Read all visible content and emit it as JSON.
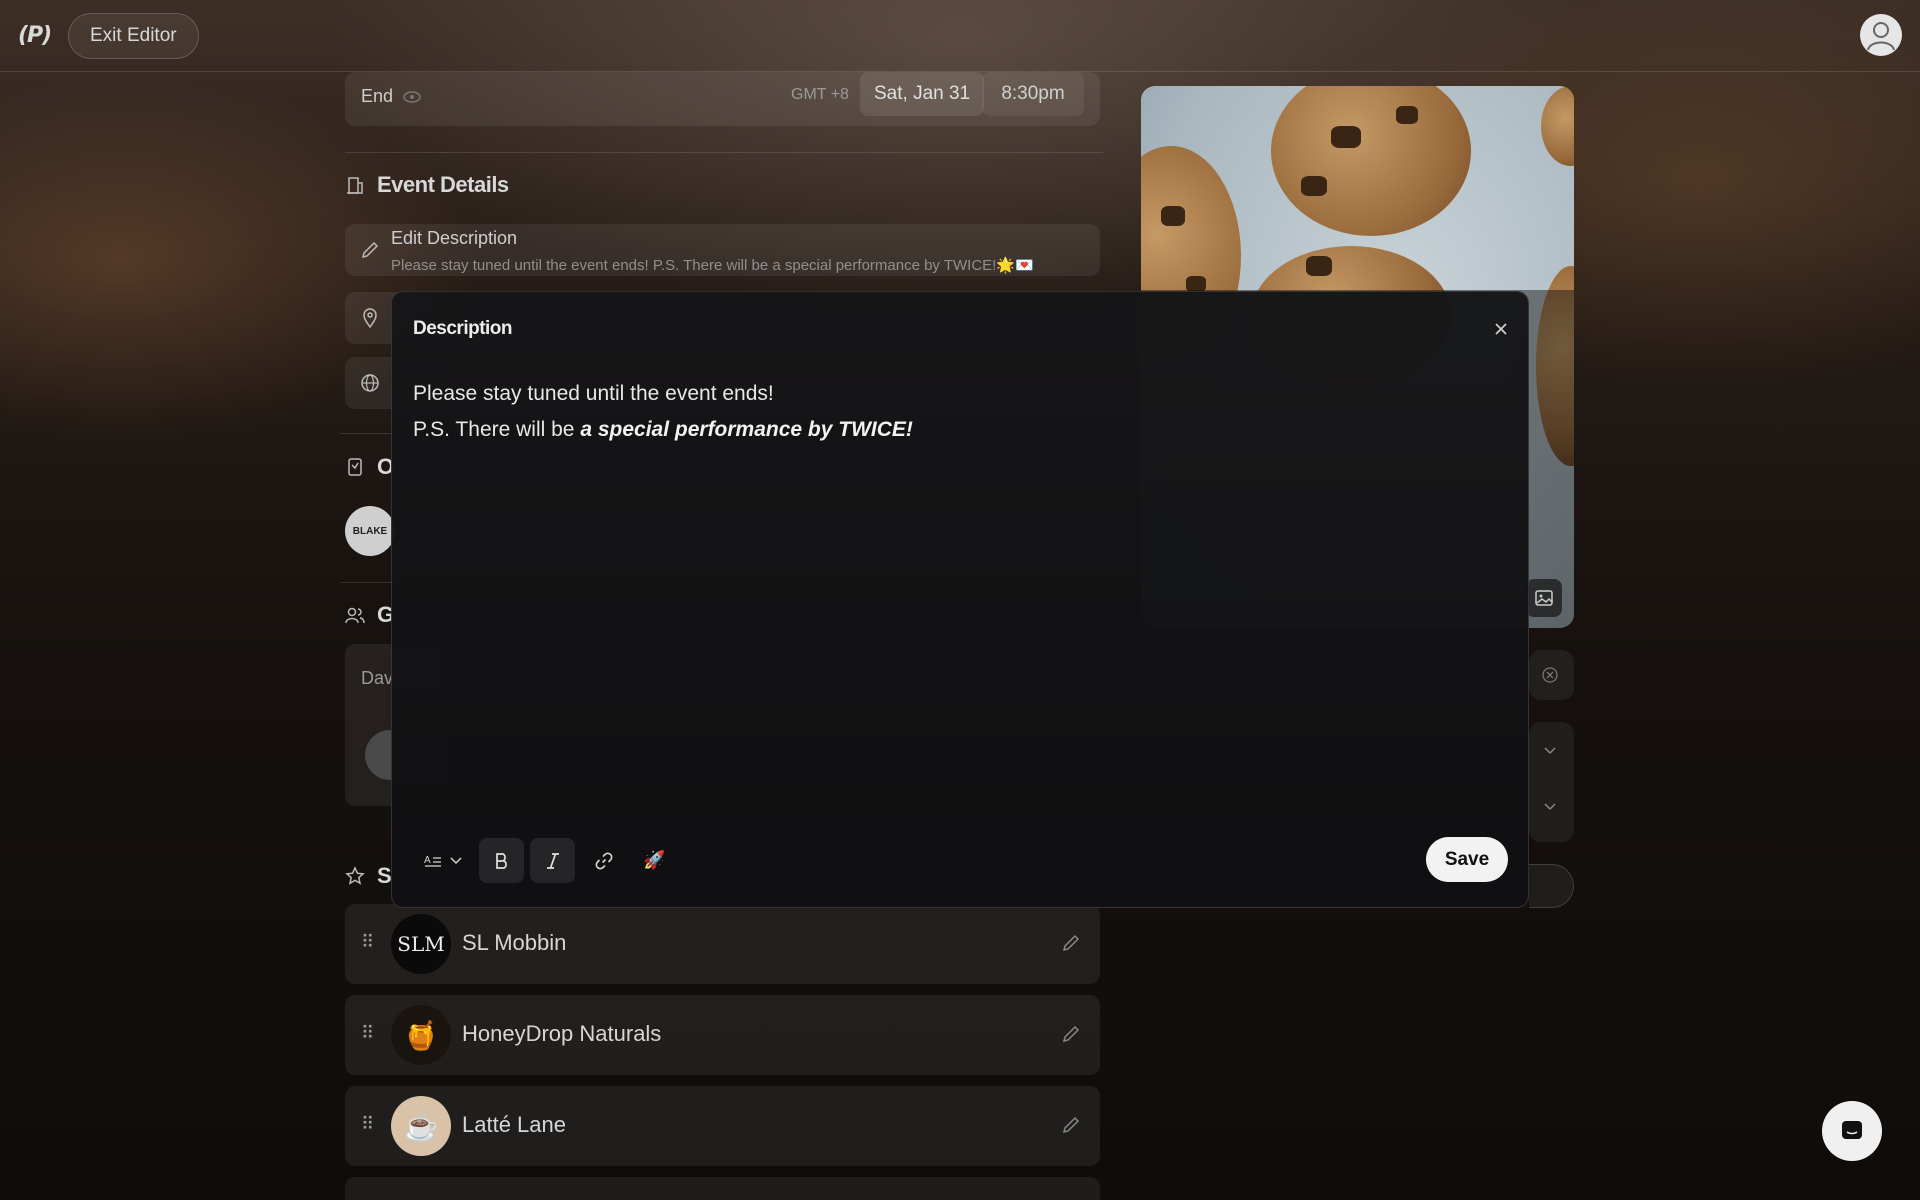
{
  "topbar": {
    "logo": "(P)",
    "exit_label": "Exit Editor"
  },
  "schedule": {
    "end_label": "End",
    "timezone": "GMT +8",
    "date": "Sat, Jan 31",
    "time": "8:30pm"
  },
  "event_details": {
    "title": "Event Details",
    "description_title": "Edit Description",
    "description_preview": "Please stay tuned until the event ends! P.S. There will be a special performance by TWICE!🌟💌"
  },
  "organizer": {
    "title_initial": "O",
    "avatar_text": "BLAKE"
  },
  "guests": {
    "title_initial": "G",
    "first_guest": "Dav"
  },
  "sponsors": {
    "title_initial": "S",
    "items": [
      {
        "name": "SL Mobbin",
        "logo_text": "SLM"
      },
      {
        "name": "HoneyDrop Naturals",
        "logo_text": "🍯"
      },
      {
        "name": "Latté Lane",
        "logo_text": "☕"
      }
    ]
  },
  "modal": {
    "title": "Description",
    "line1": "Please stay tuned until the event ends!",
    "line2_prefix": "P.S. There will be ",
    "line2_emphasis": "a special performance by TWICE!",
    "save_label": "Save",
    "rocket": "🚀"
  },
  "icons": [
    "close-icon",
    "text-style-icon",
    "chevron-down-icon",
    "bold-icon",
    "italic-icon",
    "link-icon",
    "rocket-icon",
    "pencil-icon",
    "pin-icon",
    "globe-icon",
    "image-icon",
    "chat-icon",
    "eye-icon"
  ]
}
